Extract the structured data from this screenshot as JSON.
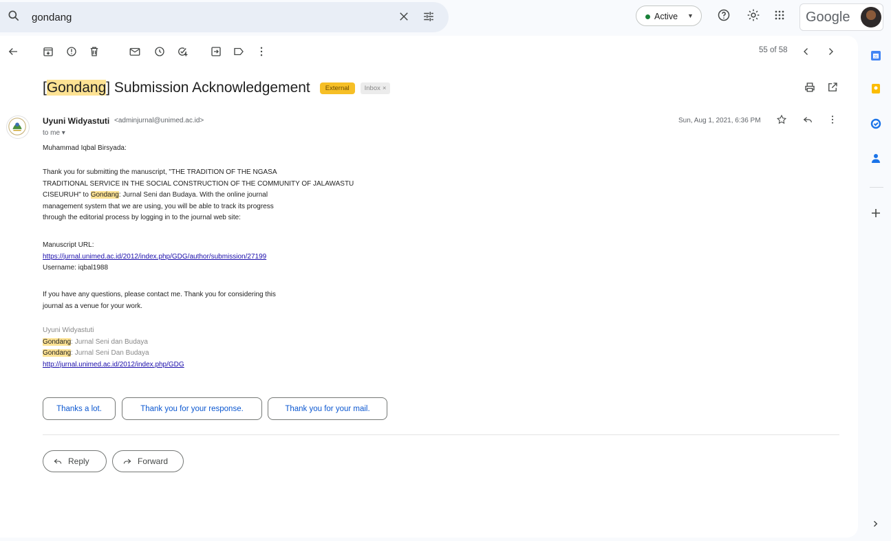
{
  "search": {
    "query": "gondang"
  },
  "status": {
    "label": "Active"
  },
  "brand": {
    "google": "Google"
  },
  "nav": {
    "counter": "55 of 58"
  },
  "email": {
    "subject_tag": "Gondang",
    "subject_rest": "] Submission Acknowledgement",
    "subject_open": "[",
    "badge_external": "External",
    "badge_inbox": "Inbox",
    "sender_name": "Uyuni Widyastuti",
    "sender_email": "<adminjurnal@unimed.ac.id>",
    "to": "to me",
    "date": "Sun, Aug 1, 2021, 6:36 PM",
    "greeting": "Muhammad Iqbal Birsyada:",
    "p1_line1": "Thank you for submitting the manuscript, \"THE TRADITION OF THE NGASA",
    "p1_line2": "TRADITIONAL SERVICE IN THE SOCIAL CONSTRUCTION OF THE COMMUNITY OF JALAWASTU",
    "p1_line3_pre": "CISEURUH\" to ",
    "p1_line3_hl": "Gondang",
    "p1_line3_post": ": Jurnal Seni dan  Budaya. With the online journal",
    "p1_line4": "management system that we are using, you will be able to track its progress",
    "p1_line5": "through the editorial process by logging in to the journal web site:",
    "url_label": "Manuscript URL:",
    "url": "https://jurnal.unimed.ac.id/2012/index.php/GDG/author/submission/27199",
    "username": "Username: iqbal1988",
    "p2_line1": "If you have any questions, please contact me. Thank you for considering this",
    "p2_line2": "journal as a venue for your work.",
    "sig_name": "Uyuni Widyastuti",
    "sig_l1_hl": "Gondang",
    "sig_l1_rest": ": Jurnal Seni dan  Budaya",
    "sig_l2_hl": "Gondang",
    "sig_l2_rest": ": Jurnal Seni Dan Budaya",
    "sig_link": "http://jurnal.unimed.ac.id/2012/index.php/GDG"
  },
  "smart_replies": [
    "Thanks a lot.",
    "Thank you for your response.",
    "Thank you for your mail."
  ],
  "actions": {
    "reply": "Reply",
    "forward": "Forward"
  },
  "colors": {
    "accent": "#0b57d0",
    "highlight": "#fde293",
    "external": "#f6bf26",
    "active": "#188038"
  }
}
